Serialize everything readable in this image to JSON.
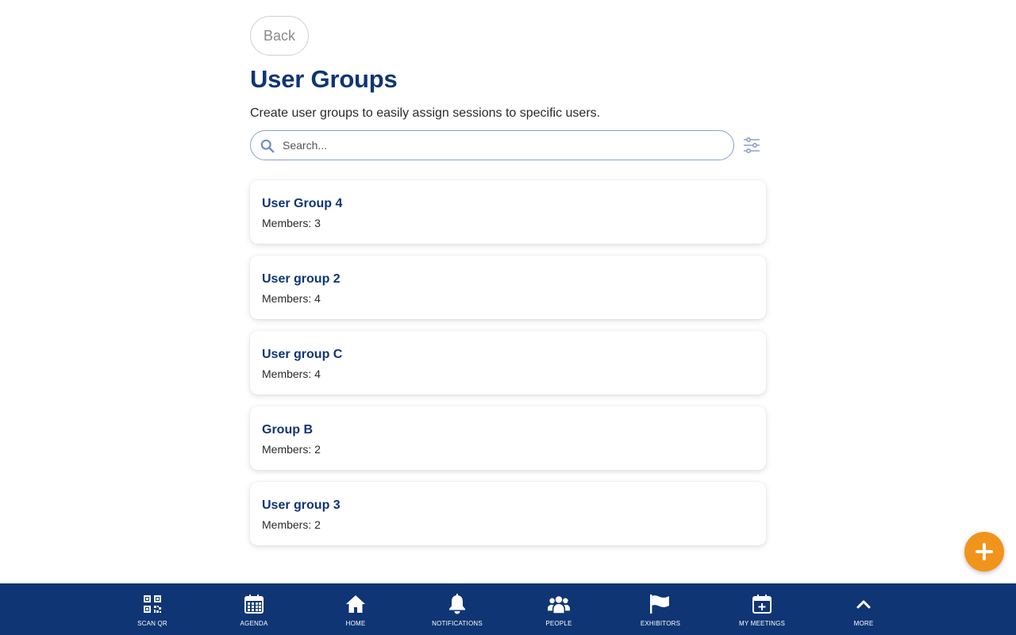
{
  "header": {
    "back_label": "Back",
    "title": "User Groups",
    "subtitle": "Create user groups to easily assign sessions to specific users."
  },
  "search": {
    "placeholder": "Search...",
    "value": ""
  },
  "groups": [
    {
      "name": "User Group 4",
      "members": "Members: 3"
    },
    {
      "name": "User group 2",
      "members": "Members: 4"
    },
    {
      "name": "User group C",
      "members": "Members: 4"
    },
    {
      "name": "Group B",
      "members": "Members: 2"
    },
    {
      "name": "User group 3",
      "members": "Members: 2"
    }
  ],
  "nav": {
    "items": [
      {
        "label": "SCAN QR",
        "icon": "qr-code-icon"
      },
      {
        "label": "AGENDA",
        "icon": "calendar-icon"
      },
      {
        "label": "HOME",
        "icon": "home-icon"
      },
      {
        "label": "NOTIFICATIONS",
        "icon": "bell-icon"
      },
      {
        "label": "PEOPLE",
        "icon": "people-icon"
      },
      {
        "label": "EXHIBITORS",
        "icon": "flag-icon"
      },
      {
        "label": "MY MEETINGS",
        "icon": "calendar-plus-icon"
      },
      {
        "label": "MORE",
        "icon": "chevron-up-icon"
      }
    ]
  },
  "fab": {
    "icon": "plus-icon"
  },
  "colors": {
    "brand": "#0f3574",
    "accent": "#f0941c",
    "search_border": "#8aa0cc"
  }
}
